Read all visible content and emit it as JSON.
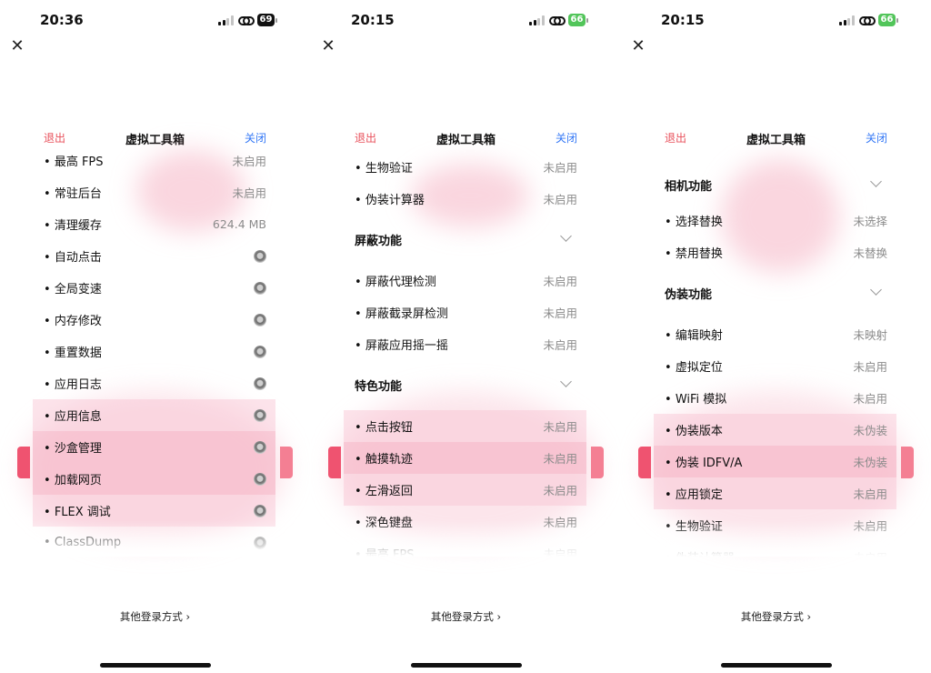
{
  "panels": [
    {
      "time": "20:36",
      "battery": "69",
      "battery_color": "#111111",
      "header": {
        "exit": "退出",
        "title": "虚拟工具箱",
        "close": "关闭"
      },
      "rows": [
        {
          "label": "最高 FPS",
          "value": "未启用"
        },
        {
          "label": "常驻后台",
          "value": "未启用"
        },
        {
          "label": "清理缓存",
          "value": "624.4 MB"
        },
        {
          "label": "自动点击",
          "toggle": "off"
        },
        {
          "label": "全局变速",
          "toggle": "off"
        },
        {
          "label": "内存修改",
          "toggle": "off"
        },
        {
          "label": "重置数据",
          "toggle": "off"
        },
        {
          "label": "应用日志",
          "toggle": "off"
        },
        {
          "label": "应用信息",
          "toggle": "off"
        },
        {
          "label": "沙盒管理",
          "toggle": "off"
        },
        {
          "label": "加载网页",
          "toggle": "off"
        },
        {
          "label": "FLEX 调试",
          "toggle": "off"
        },
        {
          "label": "ClassDump",
          "toggle": "off"
        }
      ],
      "other_login": "其他登录方式 ›"
    },
    {
      "time": "20:15",
      "battery": "66",
      "battery_color": "#52c55a",
      "header": {
        "exit": "退出",
        "title": "虚拟工具箱",
        "close": "关闭"
      },
      "items": [
        {
          "label": "生物验证",
          "value": "未启用"
        },
        {
          "label": "伪装计算器",
          "value": "未启用"
        },
        {
          "section": "屏蔽功能"
        },
        {
          "label": "屏蔽代理检测",
          "value": "未启用"
        },
        {
          "label": "屏蔽截录屏检测",
          "value": "未启用"
        },
        {
          "label": "屏蔽应用摇一摇",
          "value": "未启用"
        },
        {
          "section": "特色功能"
        },
        {
          "label": "点击按钮",
          "value": "未启用"
        },
        {
          "label": "触摸轨迹",
          "value": "未启用"
        },
        {
          "label": "左滑返回",
          "value": "未启用"
        },
        {
          "label": "深色键盘",
          "value": "未启用"
        },
        {
          "label": "最高 FPS",
          "value": "未启用"
        }
      ],
      "other_login": "其他登录方式 ›"
    },
    {
      "time": "20:15",
      "battery": "66",
      "battery_color": "#52c55a",
      "header": {
        "exit": "退出",
        "title": "虚拟工具箱",
        "close": "关闭"
      },
      "items": [
        {
          "section": "相机功能"
        },
        {
          "label": "选择替换",
          "value": "未选择"
        },
        {
          "label": "禁用替换",
          "value": "未替换"
        },
        {
          "section": "伪装功能"
        },
        {
          "label": "编辑映射",
          "value": "未映射"
        },
        {
          "label": "虚拟定位",
          "value": "未启用"
        },
        {
          "label": "WiFi 模拟",
          "value": "未启用"
        },
        {
          "label": "伪装版本",
          "value": "未伪装"
        },
        {
          "label": "伪装 IDFV/A",
          "value": "未伪装"
        },
        {
          "label": "应用锁定",
          "value": "未启用"
        },
        {
          "label": "生物验证",
          "value": "未启用"
        },
        {
          "label": "伪装计算器",
          "value": "未启用"
        }
      ],
      "other_login": "其他登录方式 ›"
    }
  ]
}
